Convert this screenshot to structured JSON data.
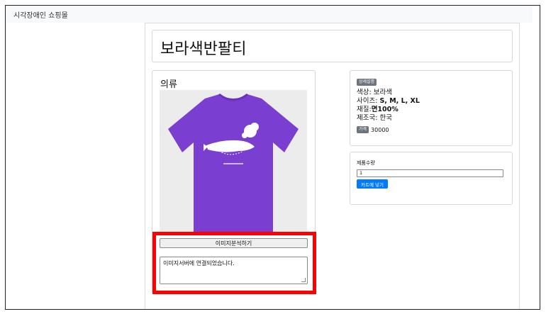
{
  "navbar": {
    "brand": "시각장애인 쇼핑몰"
  },
  "product": {
    "title": "보라색반팔티",
    "category": "의류",
    "image_alt": "purple t-shirt with white fish print"
  },
  "analysis": {
    "button_label": "이미지분석하기",
    "result_text": "이미지서버에 연결되었습니다."
  },
  "details": {
    "badge": "상세설명",
    "color_label": "색상:",
    "color_value": "보라색",
    "size_label": "사이즈:",
    "size_value": "S, M, L, XL",
    "material_label": "재질:",
    "material_value": "면100%",
    "origin_label": "제조국:",
    "origin_value": "한국",
    "price_badge": "가격",
    "price_value": "30000"
  },
  "quantity": {
    "label": "제품수량",
    "value": "1",
    "cart_button": "카트에 넣기"
  },
  "colors": {
    "accent": "#007bff",
    "highlight_border": "#ff0000",
    "shirt": "#7a3fd0",
    "badge": "#6c757d"
  }
}
